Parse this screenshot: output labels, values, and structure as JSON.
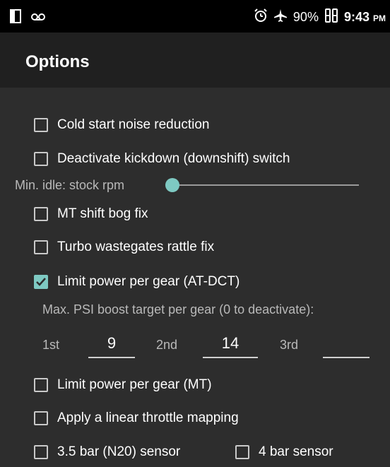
{
  "status_bar": {
    "battery": "90%",
    "time": "9:43",
    "ampm": "PM"
  },
  "app_bar": {
    "title": "Options"
  },
  "options": [
    {
      "label": "Cold start noise reduction",
      "checked": false
    },
    {
      "label": "Deactivate kickdown (downshift) switch",
      "checked": false
    },
    {
      "label": "MT shift bog fix",
      "checked": false
    },
    {
      "label": "Turbo wastegates rattle fix",
      "checked": false
    },
    {
      "label": "Limit power per gear (AT-DCT)",
      "checked": true
    },
    {
      "label": "Limit power per gear (MT)",
      "checked": false
    },
    {
      "label": "Apply a linear throttle mapping",
      "checked": false
    },
    {
      "label": "3.5 bar (N20) sensor",
      "checked": false
    },
    {
      "label": "4 bar sensor",
      "checked": false
    }
  ],
  "min_idle": {
    "label": "Min. idle: stock rpm",
    "slider_level": 0.0
  },
  "boost": {
    "hint": "Max. PSI boost target per gear (0 to deactivate):",
    "gears": [
      {
        "label": "1st",
        "value": "9"
      },
      {
        "label": "2nd",
        "value": "14"
      },
      {
        "label": "3rd",
        "value": ""
      }
    ]
  },
  "colors": {
    "accent": "#7ec9c2",
    "background": "#2d2d2d",
    "app_bar": "#202020"
  },
  "icons": [
    "screen-icon",
    "voicemail-icon",
    "alarm-icon",
    "airplane-icon",
    "battery-icon"
  ]
}
